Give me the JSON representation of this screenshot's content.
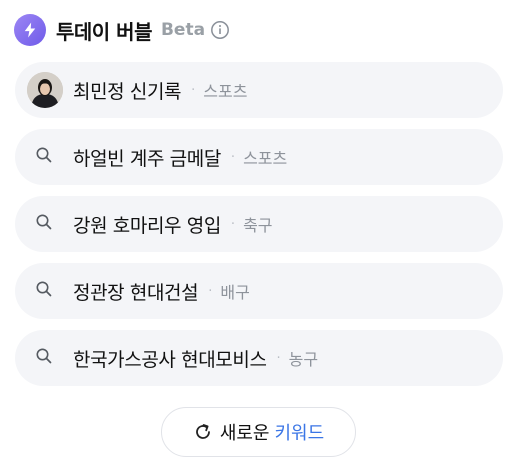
{
  "header": {
    "title": "투데이 버블",
    "badge": "Beta",
    "icons": {
      "brand": "lightning-bolt-icon",
      "info": "info-icon"
    },
    "colors": {
      "brand": "#7a66ee"
    }
  },
  "keywords": [
    {
      "keyword": "최민정 신기록",
      "separator": "·",
      "category": "스포츠",
      "lead": "avatar"
    },
    {
      "keyword": "하얼빈 계주 금메달",
      "separator": "·",
      "category": "스포츠",
      "lead": "search-icon"
    },
    {
      "keyword": "강원 호마리우 영입",
      "separator": "·",
      "category": "축구",
      "lead": "search-icon"
    },
    {
      "keyword": "정관장 현대건설",
      "separator": "·",
      "category": "배구",
      "lead": "search-icon"
    },
    {
      "keyword": "한국가스공사 현대모비스",
      "separator": "·",
      "category": "농구",
      "lead": "search-icon"
    }
  ],
  "refresh": {
    "label_part1": "새로운",
    "label_part2": "키워드",
    "icon": "refresh-icon",
    "accent": "#3b76e6"
  }
}
